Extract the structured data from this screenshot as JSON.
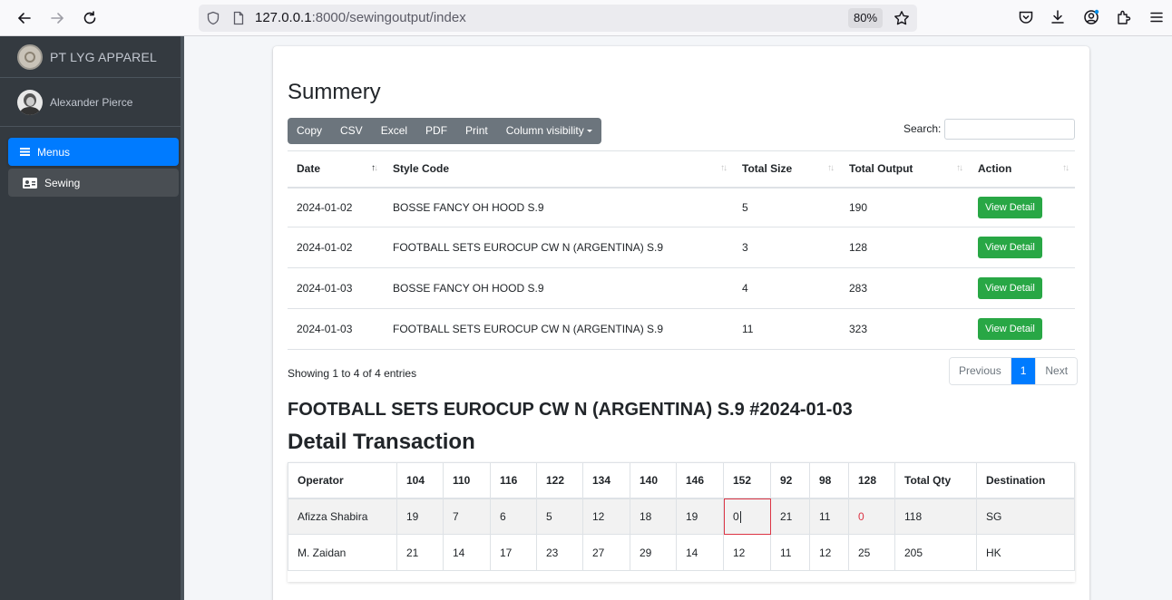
{
  "browser": {
    "url_host": "127.0.0.1",
    "url_rest": ":8000/sewingoutput/index",
    "zoom": "80%"
  },
  "sidebar": {
    "brand": "PT LYG APPAREL",
    "user": "Alexander Pierce",
    "menus_label": "Menus",
    "items": [
      {
        "label": "Sewing"
      }
    ]
  },
  "summary": {
    "title": "Summery",
    "buttons": [
      "Copy",
      "CSV",
      "Excel",
      "PDF",
      "Print",
      "Column visibility"
    ],
    "search_label": "Search:",
    "search_value": "",
    "columns": [
      "Date",
      "Style Code",
      "Total Size",
      "Total Output",
      "Action"
    ],
    "rows": [
      {
        "date": "2024-01-02",
        "style": "BOSSE FANCY OH HOOD S.9",
        "size": "5",
        "output": "190",
        "action": "View Detail"
      },
      {
        "date": "2024-01-02",
        "style": "FOOTBALL SETS EUROCUP CW N (ARGENTINA) S.9",
        "size": "3",
        "output": "128",
        "action": "View Detail"
      },
      {
        "date": "2024-01-03",
        "style": "BOSSE FANCY OH HOOD S.9",
        "size": "4",
        "output": "283",
        "action": "View Detail"
      },
      {
        "date": "2024-01-03",
        "style": "FOOTBALL SETS EUROCUP CW N (ARGENTINA) S.9",
        "size": "11",
        "output": "323",
        "action": "View Detail"
      }
    ],
    "info": "Showing 1 to 4 of 4 entries",
    "pager": {
      "previous": "Previous",
      "current": "1",
      "next": "Next"
    }
  },
  "detail": {
    "style_title": "FOOTBALL SETS EUROCUP CW N (ARGENTINA) S.9 #2024-01-03",
    "title": "Detail Transaction",
    "columns": [
      "Operator",
      "104",
      "110",
      "116",
      "122",
      "134",
      "140",
      "146",
      "152",
      "92",
      "98",
      "128",
      "Total Qty",
      "Destination"
    ],
    "rows": [
      [
        "Afizza Shabira",
        "19",
        "7",
        "6",
        "5",
        "12",
        "18",
        "19",
        "0",
        "21",
        "11",
        "0",
        "118",
        "SG"
      ],
      [
        "M. Zaidan",
        "21",
        "14",
        "17",
        "23",
        "27",
        "29",
        "14",
        "12",
        "11",
        "12",
        "25",
        "205",
        "HK"
      ]
    ]
  }
}
